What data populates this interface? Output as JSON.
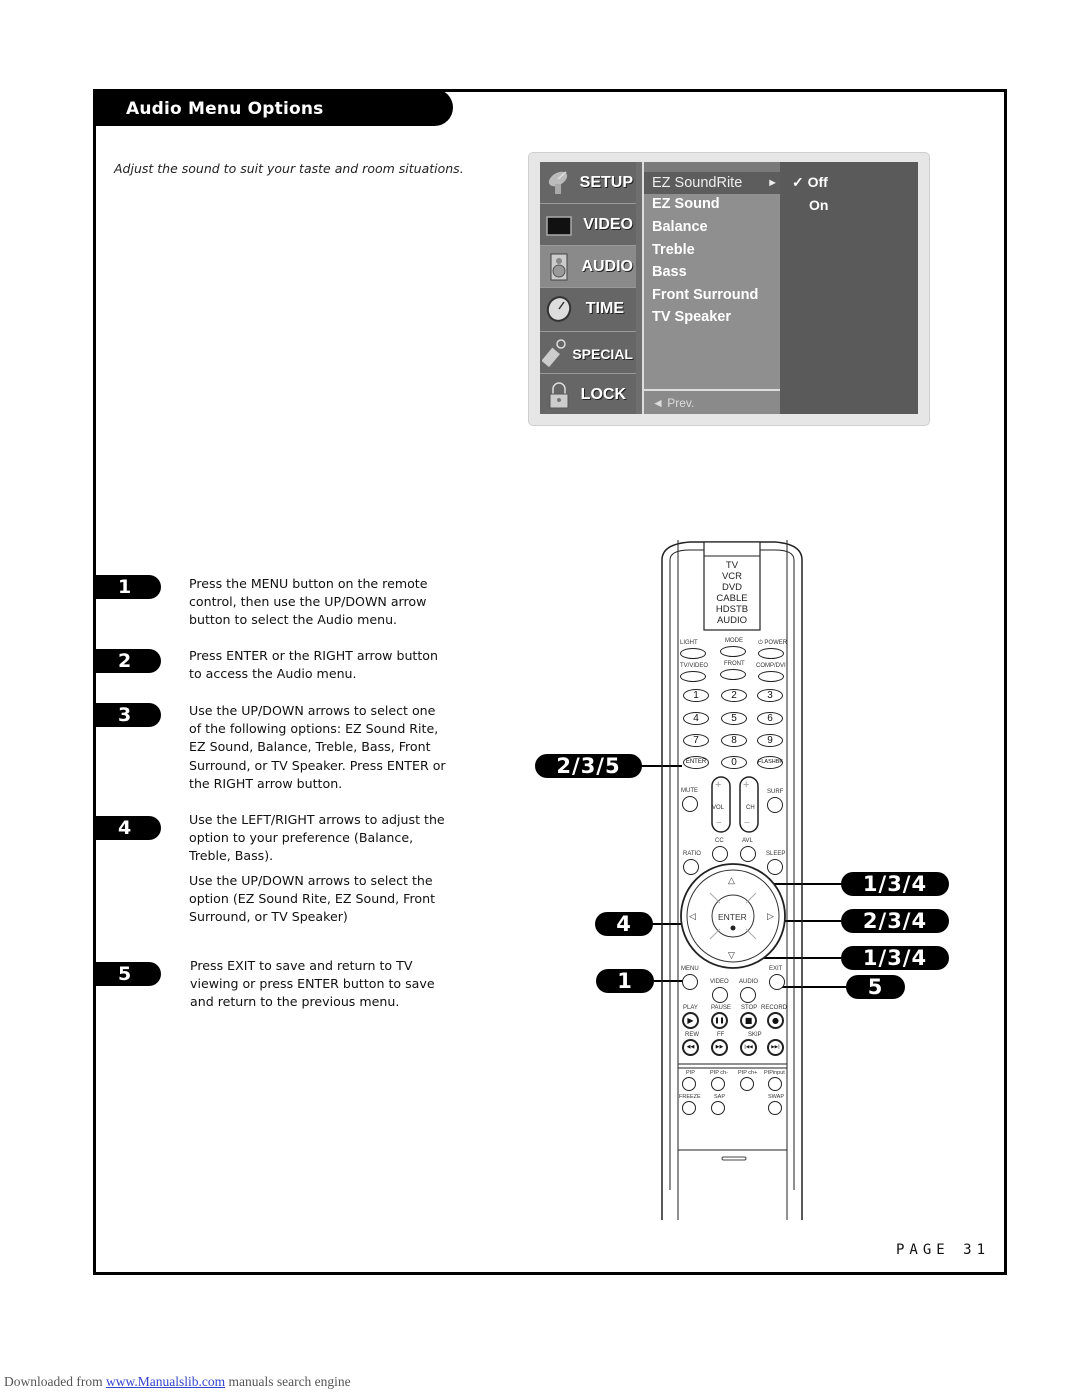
{
  "section": {
    "title": "Audio Menu Options",
    "subtitle": "Adjust the sound to suit your taste and room situations."
  },
  "osd": {
    "tabs": [
      {
        "label": "SETUP",
        "icon": "satellite-dish-icon"
      },
      {
        "label": "VIDEO",
        "icon": "tv-screen-icon"
      },
      {
        "label": "AUDIO",
        "icon": "speaker-icon",
        "active": true
      },
      {
        "label": "TIME",
        "icon": "clock-icon"
      },
      {
        "label": "SPECIAL",
        "icon": "tag-icon"
      },
      {
        "label": "LOCK",
        "icon": "padlock-icon"
      }
    ],
    "items": [
      "EZ SoundRite",
      "EZ Sound",
      "Balance",
      "Treble",
      "Bass",
      "Front Surround",
      "TV Speaker"
    ],
    "selected_item": "EZ SoundRite",
    "submenu_arrow": "►",
    "prev_label": "◄ Prev.",
    "options": [
      {
        "label": "Off",
        "checked": true,
        "check_glyph": "✓"
      },
      {
        "label": "On",
        "checked": false
      }
    ]
  },
  "steps": [
    {
      "number": "1",
      "text": "Press the MENU button on the remote control, then use the UP/DOWN arrow button to select the Audio menu."
    },
    {
      "number": "2",
      "text": "Press ENTER or the RIGHT arrow button to access the Audio menu."
    },
    {
      "number": "3",
      "text": "Use the UP/DOWN arrows to select one of the following options: EZ Sound Rite, EZ Sound, Balance, Treble, Bass, Front Surround, or TV Speaker. Press ENTER or the RIGHT arrow button."
    },
    {
      "number": "4",
      "text": "Use the LEFT/RIGHT arrows to adjust the option to your preference (Balance, Treble, Bass).",
      "text2": "Use the UP/DOWN arrows to select the option (EZ Sound Rite, EZ Sound, Front Surround, or TV Speaker)"
    },
    {
      "number": "5",
      "text": "Press EXIT to save and return to TV viewing or press ENTER button to save and return to the previous menu."
    }
  ],
  "callouts": {
    "enter_key": "2/3/5",
    "up_arrow": "1/3/4",
    "right_arrow": "2/3/4",
    "down_arrow": "1/3/4",
    "left_arrow": "4",
    "menu": "1",
    "exit": "5"
  },
  "remote": {
    "modes": [
      "TV",
      "VCR",
      "DVD",
      "CABLE",
      "HDSTB",
      "AUDIO"
    ],
    "row1": [
      "LIGHT",
      "MODE",
      "⏻ POWER"
    ],
    "row2": [
      "TV/VIDEO",
      "FRONT",
      "COMP/DVI"
    ],
    "numbers": [
      "1",
      "2",
      "3",
      "4",
      "5",
      "6",
      "7",
      "8",
      "9",
      "ENTER",
      "0",
      "FLASHBK"
    ],
    "mute": "MUTE",
    "surf": "SURF",
    "vol": "VOL",
    "ch": "CH",
    "plus": "+",
    "minus": "−",
    "cc": "CC",
    "avl": "AVL",
    "ratio": "RATIO",
    "sleep": "SLEEP",
    "enter": "ENTER",
    "menu": "MENU",
    "exit": "EXIT",
    "video": "VIDEO",
    "audio": "AUDIO",
    "transport_labels": [
      "PLAY",
      "PAUSE",
      "STOP",
      "RECORD"
    ],
    "transport_glyphs": [
      "▶",
      "❚❚",
      "■",
      "●"
    ],
    "seek_labels": [
      "REW",
      "FF",
      "SKIP"
    ],
    "seek_glyphs": [
      "◀◀",
      "▶▶",
      "|◀◀",
      "▶▶|"
    ],
    "pip_labels": [
      "PIP",
      "PIP ch-",
      "PIP ch+",
      "PIPinput"
    ],
    "bottom_labels": [
      "FREEZE",
      "SAP",
      "SWAP"
    ]
  },
  "page": {
    "label": "PAGE 31"
  },
  "footer": {
    "prefix": "Downloaded from ",
    "link": "www.Manualslib.com",
    "suffix": " manuals search engine"
  }
}
